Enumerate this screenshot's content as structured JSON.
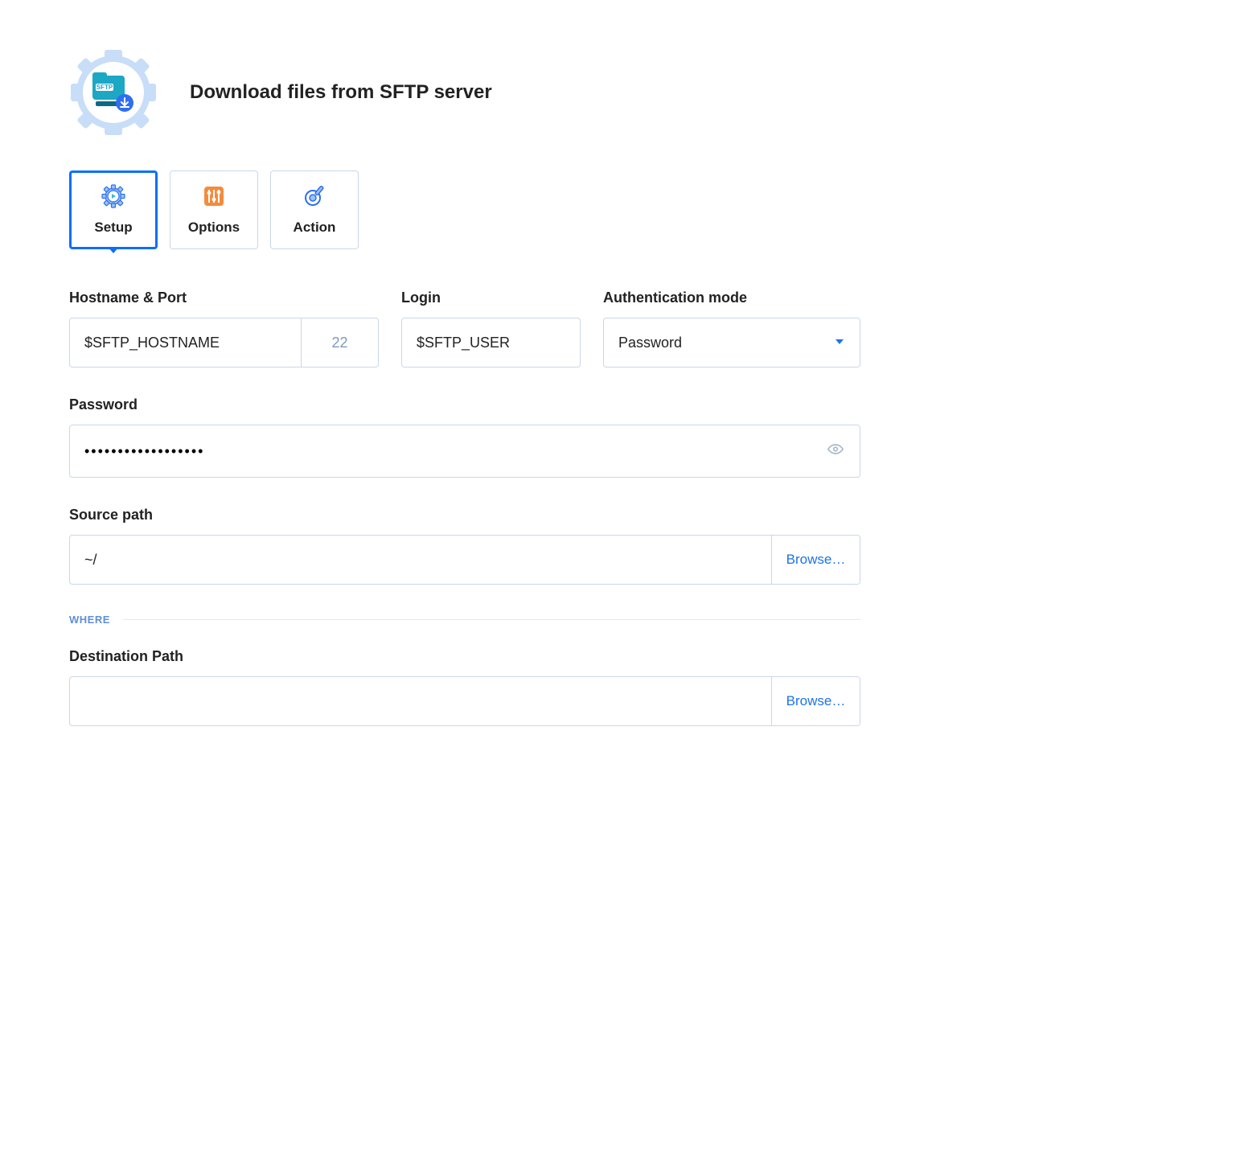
{
  "header": {
    "title": "Download files from SFTP server"
  },
  "tabs": [
    {
      "label": "Setup",
      "active": true
    },
    {
      "label": "Options",
      "active": false
    },
    {
      "label": "Action",
      "active": false
    }
  ],
  "fields": {
    "hostname_port": {
      "label": "Hostname & Port",
      "hostname_value": "$SFTP_HOSTNAME",
      "port_value": "22"
    },
    "login": {
      "label": "Login",
      "value": "$SFTP_USER"
    },
    "auth_mode": {
      "label": "Authentication mode",
      "value": "Password"
    },
    "password": {
      "label": "Password",
      "value": "••••••••••••••••••"
    },
    "source_path": {
      "label": "Source path",
      "value": "~/",
      "browse_label": "Browse…"
    },
    "destination_path": {
      "label": "Destination Path",
      "value": "",
      "browse_label": "Browse…"
    }
  },
  "sections": {
    "where": "WHERE"
  }
}
